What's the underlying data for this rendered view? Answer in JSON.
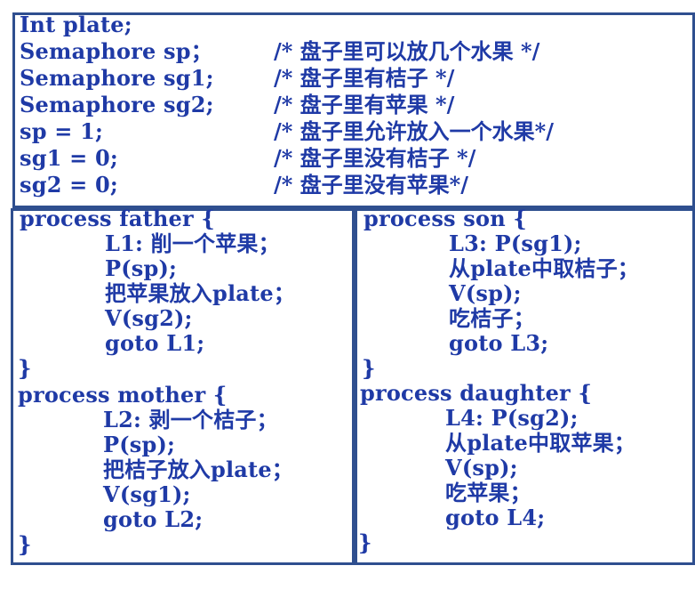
{
  "declarations": [
    {
      "code": "Int plate;",
      "comment": ""
    },
    {
      "code": "Semaphore  sp；",
      "comment": "/* 盘子里可以放几个水果 */"
    },
    {
      "code": "Semaphore  sg1;",
      "comment": "/* 盘子里有桔子 */"
    },
    {
      "code": "Semaphore  sg2;",
      "comment": "/* 盘子里有苹果 */"
    },
    {
      "code": "sp = 1;",
      "comment": "/* 盘子里允许放入一个水果*/"
    },
    {
      "code": "sg1 = 0;",
      "comment": "/* 盘子里没有桔子 */"
    },
    {
      "code": "sg2 = 0;",
      "comment": "/* 盘子里没有苹果*/"
    }
  ],
  "father": {
    "header": "process  father {",
    "body": [
      "L1: 削一个苹果；",
      "P(sp);",
      "把苹果放入plate；",
      "V(sg2);",
      "goto L1;"
    ],
    "close": "}"
  },
  "mother": {
    "header": "process  mother {",
    "body": [
      "L2: 剥一个桔子；",
      "P(sp);",
      "把桔子放入plate；",
      "V(sg1);",
      "goto L2;"
    ],
    "close": "}"
  },
  "son": {
    "header": "process  son {",
    "body": [
      "L3: P(sg1);",
      "从plate中取桔子；",
      "V(sp);",
      "吃桔子；",
      "goto L3;"
    ],
    "close": "}"
  },
  "daughter": {
    "header": "process  daughter {",
    "body": [
      "L4: P(sg2);",
      "从plate中取苹果；",
      "V(sp);",
      "吃苹果；",
      "goto L4;"
    ],
    "close": "}"
  },
  "colors": {
    "text": "#1f3aa6",
    "border": "#2f4f8f"
  }
}
